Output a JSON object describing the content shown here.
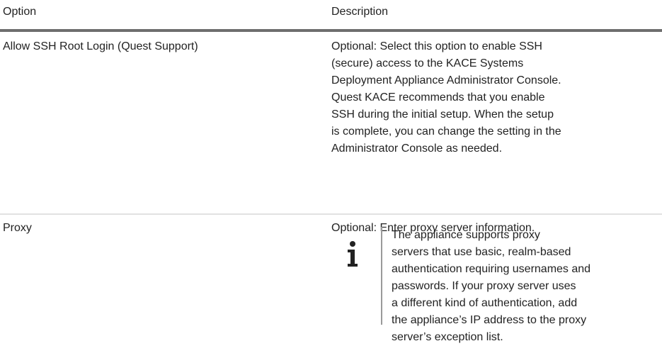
{
  "table": {
    "headers": {
      "option": "Option",
      "description": "Description"
    },
    "rows": [
      {
        "option": "Allow SSH Root Login (Quest Support)",
        "description_lines": [
          "Optional: Select this option to enable SSH",
          "(secure) access to the KACE Systems",
          "Deployment Appliance Administrator Console.",
          "Quest KACE recommends that you enable",
          "SSH during the initial setup. When the setup",
          "is complete, you can change the setting in the",
          "Administrator Console as needed."
        ]
      },
      {
        "option": "Proxy",
        "description": "Optional: Enter proxy server information.",
        "note": {
          "icon": "info-icon",
          "lines": [
            "The appliance supports proxy",
            "servers that use basic, realm-based",
            "authentication requiring usernames and",
            "passwords. If your proxy server uses",
            "a different kind of authentication, add",
            "the appliance’s IP address to the proxy",
            "server’s exception list."
          ]
        }
      }
    ]
  }
}
